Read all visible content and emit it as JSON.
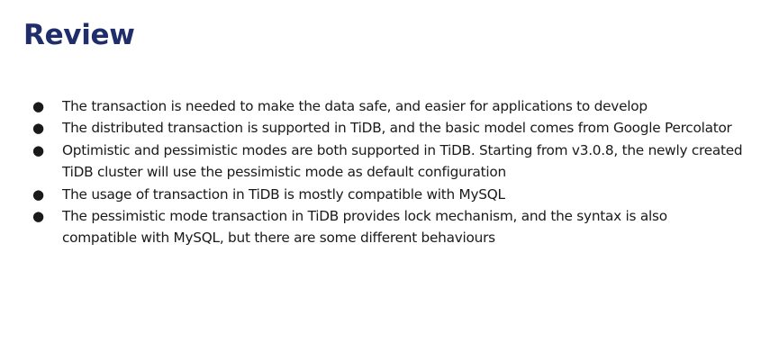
{
  "slide": {
    "title": "Review",
    "bullet_marker": "●",
    "bullets": [
      "The transaction is needed to make the data safe, and easier for applications to develop",
      "The distributed transaction is supported in TiDB, and the basic model comes from Google Percolator",
      "Optimistic and pessimistic modes are both supported in TiDB. Starting from v3.0.8, the newly created TiDB cluster will use the pessimistic mode as default configuration",
      "The usage of transaction in TiDB is mostly compatible with MySQL",
      "The pessimistic mode transaction in TiDB provides lock mechanism, and the syntax is also compatible with MySQL, but there are some different behaviours"
    ]
  },
  "colors": {
    "title": "#1f2d6b",
    "body_text": "#1a1a1a",
    "background": "#ffffff"
  }
}
